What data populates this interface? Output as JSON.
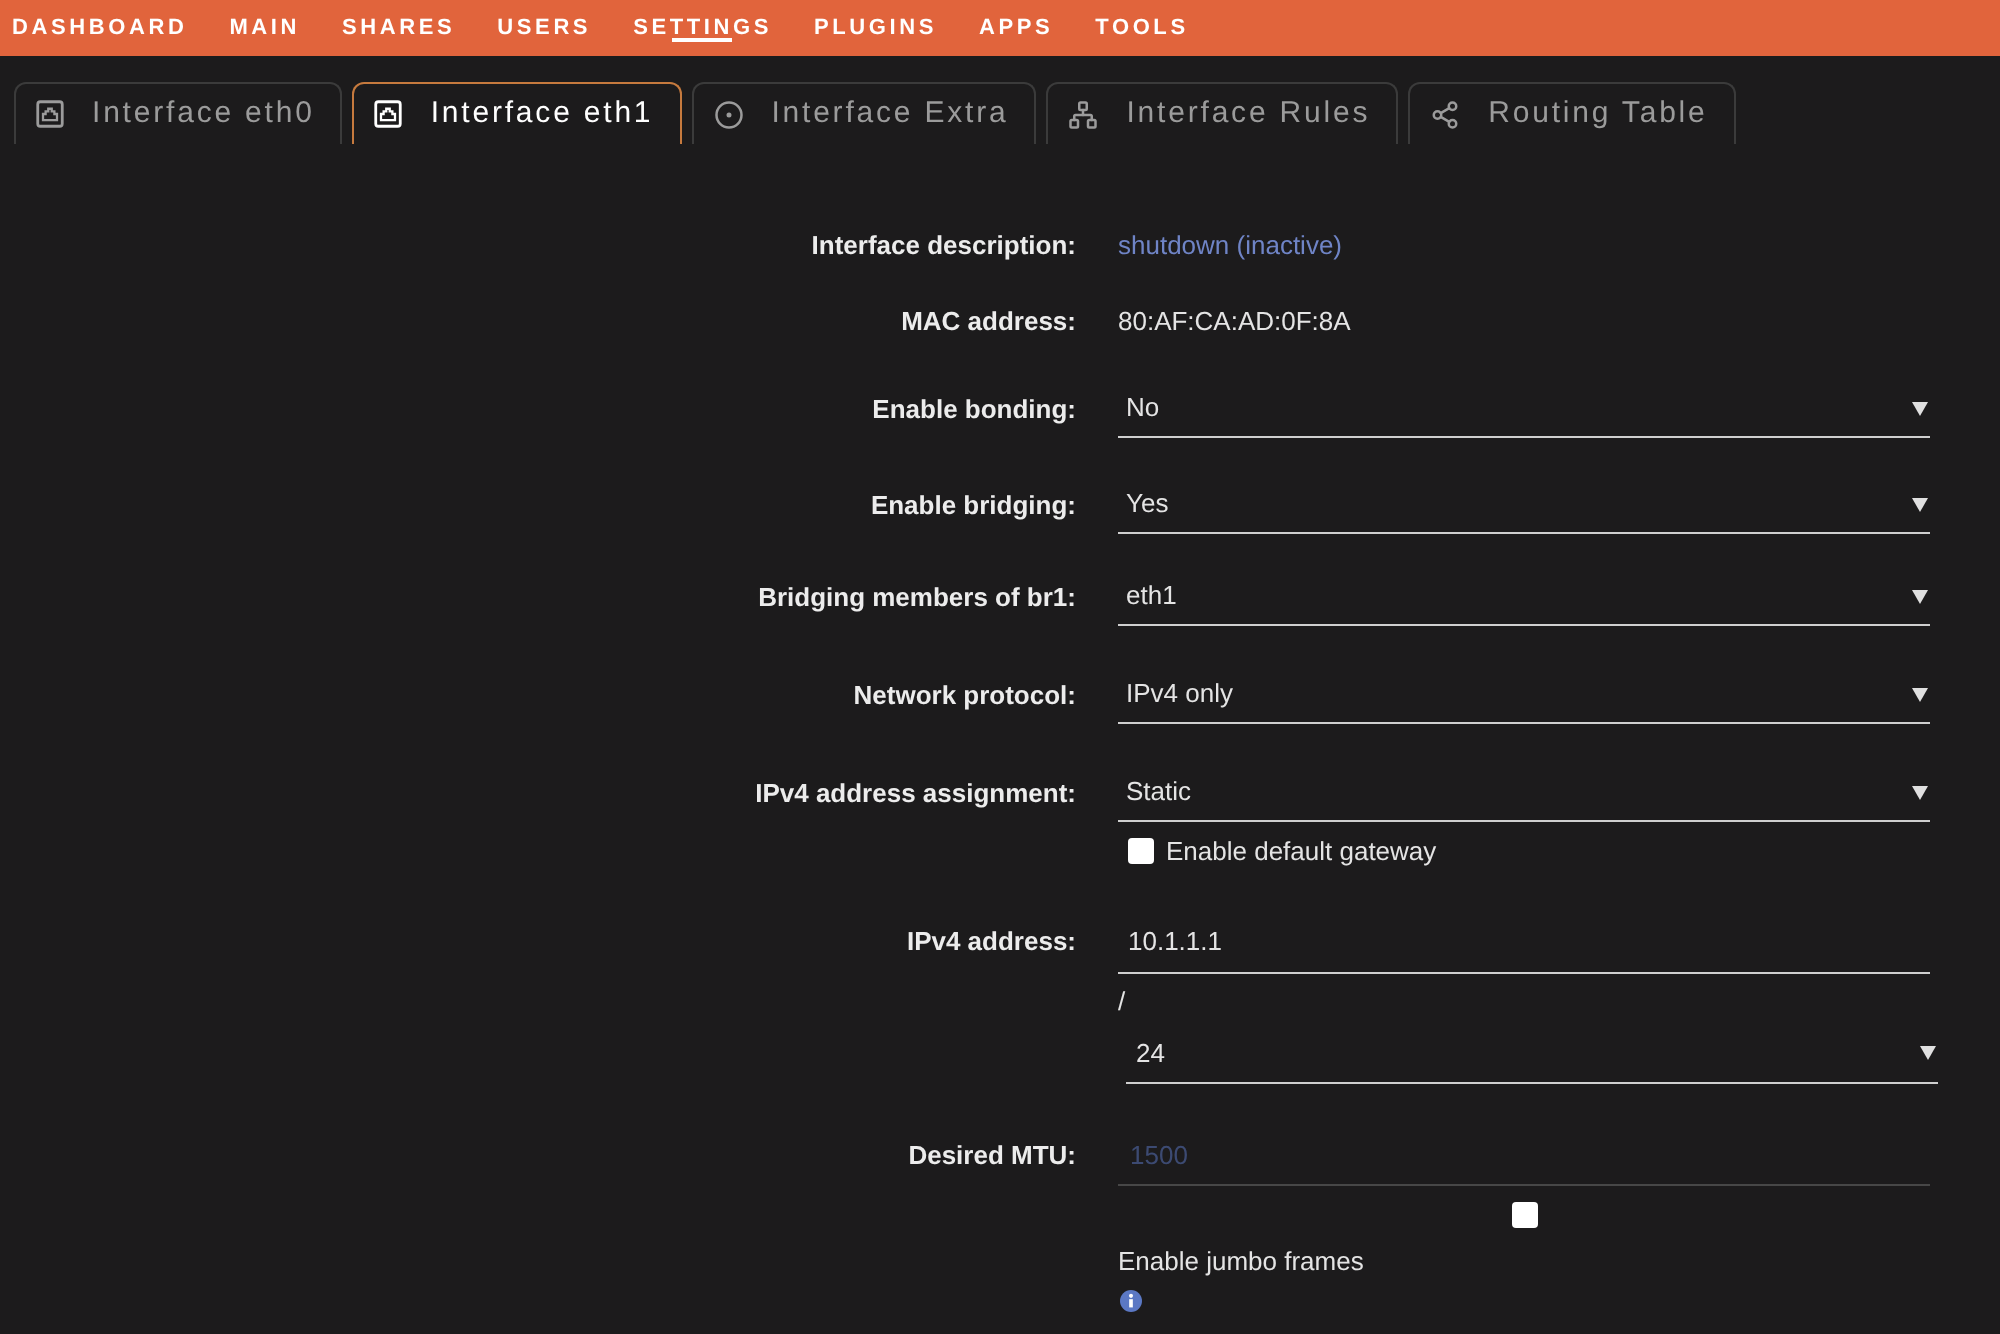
{
  "nav": [
    {
      "label": "DASHBOARD",
      "selected": false
    },
    {
      "label": "MAIN",
      "selected": false
    },
    {
      "label": "SHARES",
      "selected": false
    },
    {
      "label": "USERS",
      "selected": false
    },
    {
      "label": "SETTINGS",
      "selected": true
    },
    {
      "label": "PLUGINS",
      "selected": false
    },
    {
      "label": "APPS",
      "selected": false
    },
    {
      "label": "TOOLS",
      "selected": false
    }
  ],
  "tabs": [
    {
      "label": "Interface eth0",
      "selected": false
    },
    {
      "label": "Interface eth1",
      "selected": true
    },
    {
      "label": "Interface Extra",
      "selected": false
    },
    {
      "label": "Interface Rules",
      "selected": false
    },
    {
      "label": "Routing Table",
      "selected": false
    }
  ],
  "fields": [
    {
      "kind": "description",
      "label": "Interface description:",
      "value": "shutdown (inactive)"
    },
    {
      "kind": "text",
      "label": "MAC address:",
      "value": "80:AF:CA:AD:0F:8A"
    },
    {
      "kind": "select",
      "label": "Enable bonding:",
      "value": "No"
    },
    {
      "kind": "select",
      "label": "Enable bridging:",
      "value": "Yes"
    },
    {
      "kind": "select",
      "label": "Bridging members of br1:",
      "value": "eth1"
    },
    {
      "kind": "select",
      "label": "Network protocol:",
      "value": "IPv4 only"
    },
    {
      "kind": "select",
      "label": "IPv4 address assignment:",
      "value": "Static",
      "checkbox": {
        "label": "Enable default gateway",
        "checked": false
      }
    },
    {
      "kind": "address",
      "label": "IPv4 address:",
      "value": "10.1.1.1",
      "separator": "/",
      "prefix": "24"
    },
    {
      "kind": "input",
      "label": "Desired MTU:",
      "placeholder": "1500",
      "checkbox": {
        "label": "Enable jumbo frames",
        "checked": false
      }
    }
  ]
}
